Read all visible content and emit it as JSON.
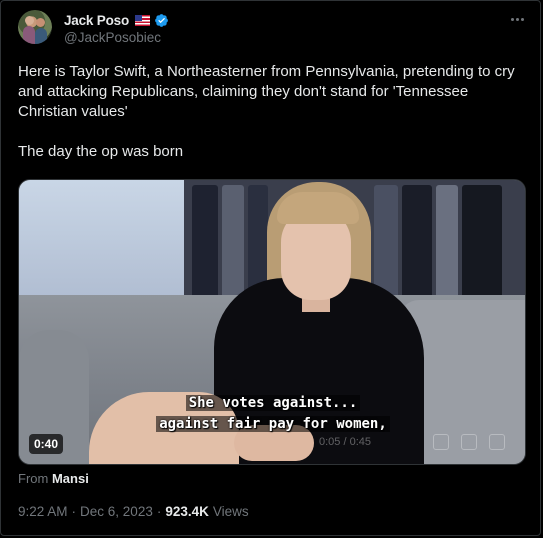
{
  "author": {
    "display_name": "Jack Poso",
    "handle": "@JackPosobiec"
  },
  "tweet": {
    "text_line1": "Here is Taylor Swift, a Northeasterner from Pennsylvania, pretending to cry and attacking Republicans, claiming they don't stand for 'Tennessee Christian values'",
    "text_line2": "The day the op was born"
  },
  "video": {
    "subtitle_line1": "She votes against...",
    "subtitle_line2": "against fair pay for women,",
    "duration": "0:40",
    "ghost_time": "0:05 / 0:45"
  },
  "source": {
    "prefix": "From",
    "name": "Mansi"
  },
  "meta": {
    "time": "9:22 AM",
    "separator1": "·",
    "date": "Dec 6, 2023",
    "separator2": "·",
    "views_count": "923.4K",
    "views_label": "Views"
  },
  "colors": {
    "background": "#000000",
    "text": "#e7e9ea",
    "muted": "#71767b",
    "verified": "#1d9bf0"
  },
  "icons": [
    "flag-usa-icon",
    "verified-badge-icon",
    "more-options-icon"
  ]
}
